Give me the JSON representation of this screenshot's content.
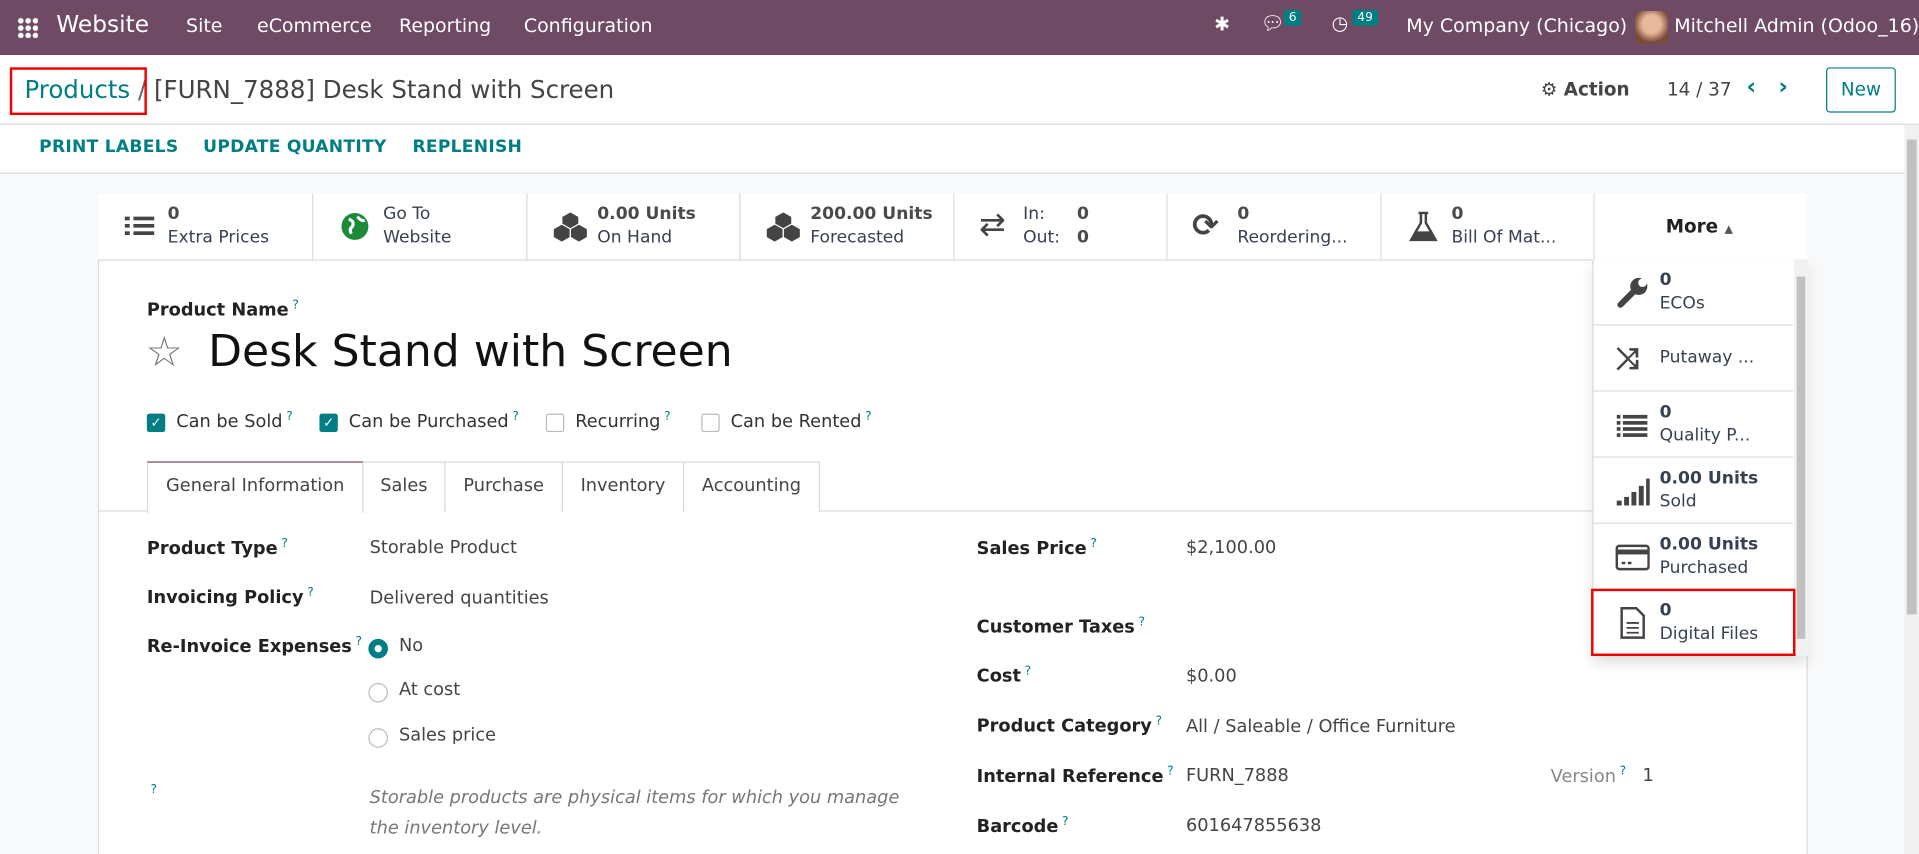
{
  "navbar": {
    "app": "Website",
    "menu": [
      "Site",
      "eCommerce",
      "Reporting",
      "Configuration"
    ],
    "messages_count": "6",
    "activities_count": "49",
    "company": "My Company (Chicago)",
    "user": "Mitchell Admin (Odoo_16)",
    "color": "#714B67"
  },
  "breadcrumb": {
    "parent": "Products",
    "separator": "/",
    "current": "[FURN_7888] Desk Stand with Screen"
  },
  "controls": {
    "action": "Action",
    "pager": "14 / 37",
    "new": "New"
  },
  "buttons": [
    "PRINT LABELS",
    "UPDATE QUANTITY",
    "REPLENISH"
  ],
  "stats": [
    {
      "icon": "list-icon",
      "value": "0",
      "label": "Extra Prices"
    },
    {
      "icon": "globe-icon",
      "value": "Go To",
      "label": "Website"
    },
    {
      "icon": "cubes-icon",
      "value": "0.00 Units",
      "label": "On Hand"
    },
    {
      "icon": "cubes-icon",
      "value": "200.00 Units",
      "label": "Forecasted"
    },
    {
      "icon": "exchange-icon",
      "in_label": "In:",
      "in_value": "0",
      "out_label": "Out:",
      "out_value": "0"
    },
    {
      "icon": "refresh-icon",
      "value": "0",
      "label": "Reordering..."
    },
    {
      "icon": "flask-icon",
      "value": "0",
      "label": "Bill Of Mat..."
    }
  ],
  "more": {
    "label": "More",
    "items": [
      {
        "icon": "wrench-icon",
        "value": "0",
        "label": "ECOs"
      },
      {
        "icon": "random-icon",
        "value": "",
        "label": "Putaway ..."
      },
      {
        "icon": "list-icon",
        "value": "0",
        "label": "Quality P..."
      },
      {
        "icon": "signal-icon",
        "value": "0.00 Units",
        "label": "Sold"
      },
      {
        "icon": "credit-card-icon",
        "value": "0.00 Units",
        "label": "Purchased"
      },
      {
        "icon": "file-text-icon",
        "value": "0",
        "label": "Digital Files"
      }
    ]
  },
  "form": {
    "product_name_label": "Product Name",
    "product_name": "Desk Stand with Screen",
    "checkboxes": [
      {
        "label": "Can be Sold",
        "checked": true
      },
      {
        "label": "Can be Purchased",
        "checked": true
      },
      {
        "label": "Recurring",
        "checked": false
      },
      {
        "label": "Can be Rented",
        "checked": false
      }
    ],
    "tabs": [
      "General Information",
      "Sales",
      "Purchase",
      "Inventory",
      "Accounting"
    ],
    "active_tab": "General Information",
    "left": {
      "product_type_label": "Product Type",
      "product_type": "Storable Product",
      "invoicing_policy_label": "Invoicing Policy",
      "invoicing_policy": "Delivered quantities",
      "reinvoice_label": "Re-Invoice Expenses",
      "reinvoice_options": [
        "No",
        "At cost",
        "Sales price"
      ],
      "reinvoice_selected": "No",
      "help": "Storable products are physical items for which you manage the inventory level."
    },
    "right": {
      "sales_price_label": "Sales Price",
      "sales_price": "$2,100.00",
      "customer_taxes_label": "Customer Taxes",
      "cost_label": "Cost",
      "cost": "$0.00",
      "category_label": "Product Category",
      "category": "All / Saleable / Office Furniture",
      "internal_ref_label": "Internal Reference",
      "internal_ref": "FURN_7888",
      "version_label": "Version",
      "version": "1",
      "barcode_label": "Barcode",
      "barcode": "601647855638"
    },
    "help_mark": "?"
  }
}
